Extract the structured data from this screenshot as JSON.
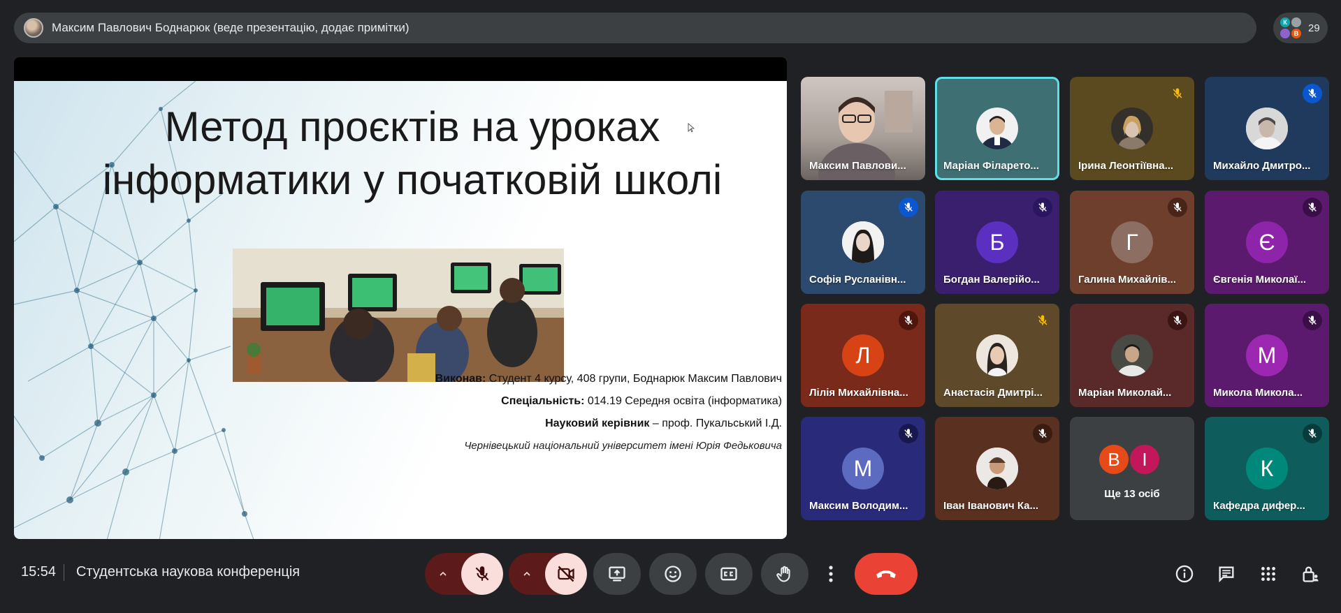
{
  "presenter_bar": {
    "title": "Максим Павлович Боднарюк (веде презентацію, додає примітки)"
  },
  "participants_chip": {
    "count": "29",
    "mini_avatars": [
      {
        "letter": "К",
        "color": "#12a4af"
      },
      {
        "letter": "",
        "color": "#9aa0a6"
      },
      {
        "letter": "",
        "color": "#8e63ce"
      },
      {
        "letter": "В",
        "color": "#e8590c"
      }
    ]
  },
  "slide": {
    "title_line1": "Метод проєктів на уроках",
    "title_line2": "інформатики у початковій школі",
    "author_label": "Виконав:",
    "author_text": " Студент 4 курсу, 408 групи, Боднарюк Максим Павлович",
    "specialty_label": "Спеціальність:",
    "specialty_text": " 014.19 Середня освіта (інформатика)",
    "supervisor_label": "Науковий керівник",
    "supervisor_text": " – проф. Пукальський І.Д.",
    "university": "Чернівецький національний університет імені Юрія Федьковича"
  },
  "tiles": [
    {
      "name": "Максим Павлови...",
      "type": "video",
      "muted": false
    },
    {
      "name": "Маріан Філарето...",
      "type": "photo",
      "muted": false,
      "active": true
    },
    {
      "name": "Ірина Леонтіївна...",
      "type": "photo",
      "muted": true
    },
    {
      "name": "Михайло Дмитро...",
      "type": "photo",
      "muted": true
    },
    {
      "name": "Софія Русланівн...",
      "type": "photo",
      "muted": true
    },
    {
      "name": "Богдан Валерійо...",
      "type": "letter",
      "letter": "Б",
      "muted": true
    },
    {
      "name": "Галина Михайлів...",
      "type": "letter",
      "letter": "Г",
      "muted": true
    },
    {
      "name": "Євгенія Миколаї...",
      "type": "letter",
      "letter": "Є",
      "muted": true
    },
    {
      "name": "Лілія Михайлівна...",
      "type": "letter",
      "letter": "Л",
      "muted": true
    },
    {
      "name": "Анастасія Дмитрі...",
      "type": "photo",
      "muted": true
    },
    {
      "name": "Маріан Миколай...",
      "type": "photo",
      "muted": true
    },
    {
      "name": "Микола Микола...",
      "type": "letter",
      "letter": "М",
      "muted": true
    },
    {
      "name": "Максим Володим...",
      "type": "letter",
      "letter": "М",
      "muted": true
    },
    {
      "name": "Іван Іванович Ка...",
      "type": "photo",
      "muted": true
    },
    {
      "name": "Ще 13 осіб",
      "type": "more",
      "letters": [
        "В",
        "І"
      ]
    },
    {
      "name": "Кафедра дифер...",
      "type": "letter",
      "letter": "К",
      "muted": true
    }
  ],
  "bottom": {
    "time": "15:54",
    "meeting_title": "Студентська наукова конференція"
  },
  "colors": {
    "background": "#202124",
    "surface": "#3c4043",
    "active_border": "#5fe0e8",
    "hangup": "#ea4335",
    "muted_control_bg": "#f9dedc",
    "muted_control_group": "#5c1a1a"
  }
}
